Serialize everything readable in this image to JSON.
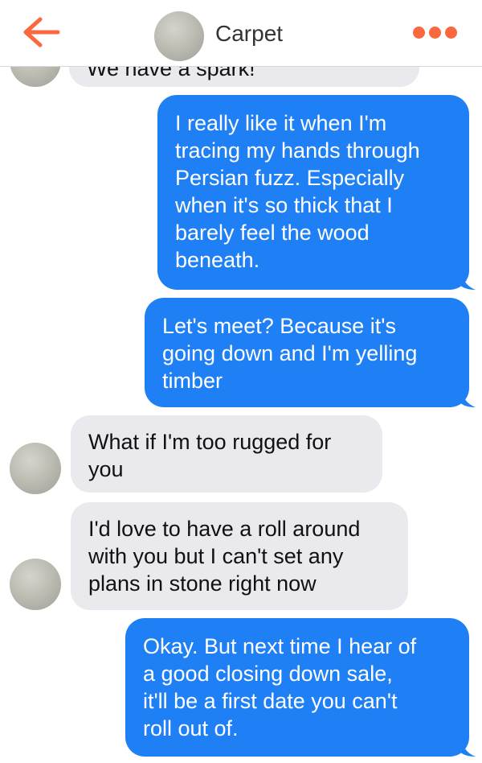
{
  "header": {
    "contact_name": "Carpet",
    "back_icon": "arrow-left-icon",
    "more_icon": "more-dots-icon",
    "accent_color": "#f9683f"
  },
  "messages": [
    {
      "direction": "incoming",
      "lines": [
        "We have a spark!"
      ]
    },
    {
      "direction": "outgoing",
      "lines": [
        "I really like it when I'm",
        "tracing my hands through",
        "Persian fuzz. Especially",
        "when it's so thick that I",
        "barely feel the wood",
        "beneath."
      ]
    },
    {
      "direction": "outgoing",
      "lines": [
        "Let's meet? Because it's",
        "going down and I'm yelling",
        "timber"
      ]
    },
    {
      "direction": "incoming",
      "lines": [
        "What if I'm too rugged for",
        "you"
      ]
    },
    {
      "direction": "incoming",
      "lines": [
        "I'd love to have a roll around",
        "with you but I can't set any",
        "plans in stone right now"
      ]
    },
    {
      "direction": "outgoing",
      "lines": [
        "Okay. But next time I hear of",
        "a good closing down sale,",
        "it'll be a first date you can't",
        "roll out of."
      ]
    }
  ],
  "colors": {
    "outgoing_bubble": "#1f80f5",
    "incoming_bubble": "#e9e9ee"
  }
}
